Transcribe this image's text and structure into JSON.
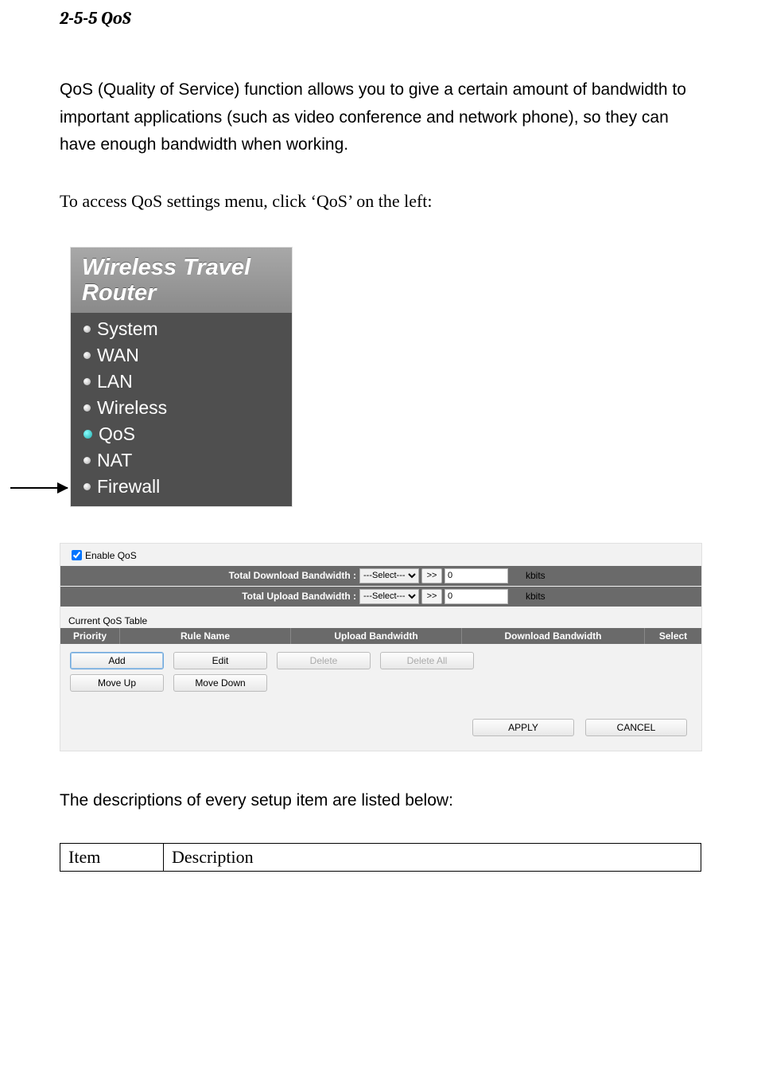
{
  "section_title": "2-5-5 QoS",
  "intro_paragraph": "QoS (Quality of Service) function allows you to give a certain amount of bandwidth to important applications (such as video conference and network phone), so they can have enough bandwidth when working.",
  "access_paragraph": "To access QoS settings menu, click ‘QoS’ on the left:",
  "nav": {
    "title_line1": "Wireless Travel",
    "title_line2": "Router",
    "items": [
      {
        "label": "System",
        "active": false
      },
      {
        "label": "WAN",
        "active": false
      },
      {
        "label": "LAN",
        "active": false
      },
      {
        "label": "Wireless",
        "active": false
      },
      {
        "label": "QoS",
        "active": true
      },
      {
        "label": "NAT",
        "active": false
      },
      {
        "label": "Firewall",
        "active": false
      }
    ]
  },
  "qos": {
    "enable_label": "Enable QoS",
    "enable_checked": true,
    "download_label": "Total Download Bandwidth :",
    "upload_label": "Total Upload Bandwidth :",
    "select_placeholder": "---Select---",
    "transfer_btn": ">>",
    "download_value": "0",
    "upload_value": "0",
    "unit": "kbits",
    "table_title": "Current QoS Table",
    "headers": {
      "priority": "Priority",
      "rule_name": "Rule Name",
      "upload": "Upload Bandwidth",
      "download": "Download Bandwidth",
      "select": "Select"
    },
    "buttons": {
      "add": "Add",
      "edit": "Edit",
      "delete": "Delete",
      "delete_all": "Delete All",
      "move_up": "Move Up",
      "move_down": "Move Down",
      "apply": "APPLY",
      "cancel": "CANCEL"
    }
  },
  "desc_intro": "The descriptions of every setup item are listed below:",
  "desc_table": {
    "header_item": "Item",
    "header_description": "Description"
  }
}
